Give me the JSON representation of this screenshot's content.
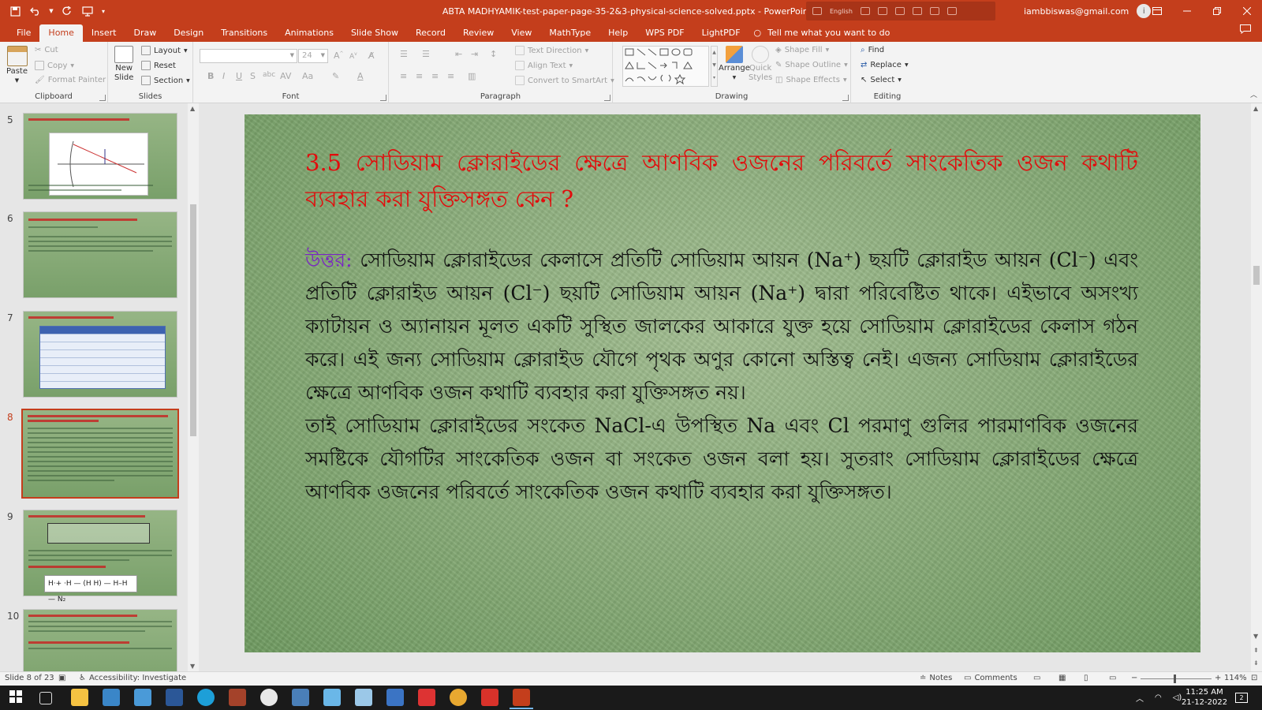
{
  "window": {
    "title": "ABTA MADHYAMIK-test-paper-page-35-2&3-physical-science-solved.pptx  -  PowerPoint",
    "language_indicator": "English",
    "user_email": "iambbiswas@gmail.com",
    "avatar_letter": "i",
    "theme_color": "#c43e1c"
  },
  "ribbon_tabs": [
    "File",
    "Home",
    "Insert",
    "Draw",
    "Design",
    "Transitions",
    "Animations",
    "Slide Show",
    "Record",
    "Review",
    "View",
    "MathType",
    "Help",
    "WPS PDF",
    "LightPDF"
  ],
  "active_tab": "Home",
  "tell_me": "Tell me what you want to do",
  "ribbon": {
    "clipboard": {
      "label": "Clipboard",
      "paste": "Paste",
      "cut": "Cut",
      "copy": "Copy",
      "format_painter": "Format Painter"
    },
    "slides": {
      "label": "Slides",
      "new_slide_1": "New",
      "new_slide_2": "Slide",
      "layout": "Layout",
      "reset": "Reset",
      "section": "Section"
    },
    "font": {
      "label": "Font",
      "font_size": "24"
    },
    "paragraph": {
      "label": "Paragraph",
      "text_direction": "Text Direction",
      "align_text": "Align Text",
      "convert_smartart": "Convert to SmartArt"
    },
    "drawing": {
      "label": "Drawing",
      "arrange": "Arrange",
      "quick_styles_1": "Quick",
      "quick_styles_2": "Styles",
      "shape_fill": "Shape Fill",
      "shape_outline": "Shape Outline",
      "shape_effects": "Shape Effects"
    },
    "editing": {
      "label": "Editing",
      "find": "Find",
      "replace": "Replace",
      "select": "Select"
    }
  },
  "thumbnails": [
    {
      "num": "5",
      "kind": "diagram"
    },
    {
      "num": "6",
      "kind": "text"
    },
    {
      "num": "7",
      "kind": "table"
    },
    {
      "num": "8",
      "kind": "text",
      "selected": true
    },
    {
      "num": "9",
      "kind": "formula",
      "formula_text": "H·+ ·H — (H H) — H–H — N₂"
    },
    {
      "num": "10",
      "kind": "text"
    }
  ],
  "slide": {
    "title": "3.5 সোডিয়াম ক্লোরাইডের ক্ষেত্রে আণবিক ওজনের পরিবর্তে সাংকেতিক ওজন কথাটি ব্যবহার করা যুক্তিসঙ্গত কেন ?",
    "answer_label": "উত্তর:",
    "paragraph1": " সোডিয়াম ক্লোরাইডের কেলাসে প্রতিটি সোডিয়াম আয়ন (Na⁺) ছয়টি ক্লোরাইড আয়ন (Cl⁻) এবং প্রতিটি ক্লোরাইড আয়ন (Cl⁻) ছয়টি সোডিয়াম আয়ন (Na⁺) দ্বারা পরিবেষ্টিত থাকে। এইভাবে অসংখ্য ক্যাটায়ন ও অ্যানায়ন মূলত একটি সুস্থিত জালকের আকারে যুক্ত হয়ে সোডিয়াম ক্লোরাইডের কেলাস গঠন করে। এই জন্য সোডিয়াম ক্লোরাইড যৌগে পৃথক অণুর কোনো অস্তিত্ব নেই। এজন্য সোডিয়াম ক্লোরাইডের ক্ষেত্রে আণবিক ওজন কথাটি ব্যবহার করা যুক্তিসঙ্গত নয়।",
    "paragraph2": "তাই সোডিয়াম ক্লোরাইডের সংকেত NaCl-এ উপস্থিত Na এবং Cl পরমাণু গুলির পারমাণবিক ওজনের সমষ্টিকে যৌগটির সাংকেতিক ওজন বা সংকেত ওজন বলা হয়। সুতরাং সোডিয়াম ক্লোরাইডের ক্ষেত্রে আণবিক ওজনের পরিবর্তে সাংকেতিক ওজন কথাটি ব্যবহার করা যুক্তিসঙ্গত।",
    "title_color": "#e20c0c",
    "label_color": "#7a24c4"
  },
  "status": {
    "slide_info": "Slide 8 of 23",
    "accessibility": "Accessibility: Investigate",
    "notes": "Notes",
    "comments": "Comments",
    "zoom": "114%"
  },
  "taskbar": {
    "time": "11:25 AM",
    "date": "21-12-2022",
    "notification_count": "2"
  }
}
